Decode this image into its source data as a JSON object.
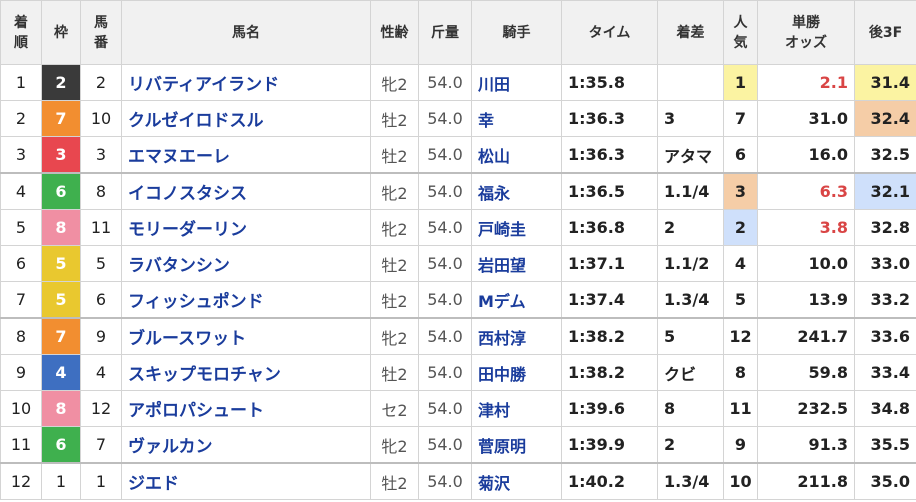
{
  "headers": {
    "rank": "着\n順",
    "frame": "枠",
    "number": "馬\n番",
    "horse": "馬名",
    "sexage": "性齢",
    "weight": "斤量",
    "jockey": "騎手",
    "time": "タイム",
    "margin": "着差",
    "popularity": "人\n気",
    "odds": "単勝\nオッズ",
    "last3f": "後3F"
  },
  "frame_colors": {
    "1": {
      "bg": "#ffffff",
      "fg": "#222222"
    },
    "2": {
      "bg": "#3a3a3a",
      "fg": "#ffffff"
    },
    "3": {
      "bg": "#e8474f",
      "fg": "#ffffff"
    },
    "4": {
      "bg": "#3e6fc1",
      "fg": "#ffffff"
    },
    "5": {
      "bg": "#e9c82f",
      "fg": "#ffffff"
    },
    "6": {
      "bg": "#3fb04e",
      "fg": "#ffffff"
    },
    "7": {
      "bg": "#f28e30",
      "fg": "#ffffff"
    },
    "8": {
      "bg": "#f08fa3",
      "fg": "#ffffff"
    }
  },
  "rows": [
    {
      "rank": "1",
      "frame": "2",
      "number": "2",
      "horse": "リバティアイランド",
      "sexage": "牝2",
      "weight": "54.0",
      "jockey": "川田",
      "time": "1:35.8",
      "margin": "",
      "popularity": "1",
      "odds": "2.1",
      "last3f": "31.4",
      "odds_hot": true,
      "l3f_rank": 1
    },
    {
      "rank": "2",
      "frame": "7",
      "number": "10",
      "horse": "クルゼイロドスル",
      "sexage": "牡2",
      "weight": "54.0",
      "jockey": "幸",
      "time": "1:36.3",
      "margin": "3",
      "popularity": "7",
      "odds": "31.0",
      "last3f": "32.4",
      "odds_hot": false,
      "l3f_rank": 3
    },
    {
      "rank": "3",
      "frame": "3",
      "number": "3",
      "horse": "エマヌエーレ",
      "sexage": "牡2",
      "weight": "54.0",
      "jockey": "松山",
      "time": "1:36.3",
      "margin": "アタマ",
      "popularity": "6",
      "odds": "16.0",
      "last3f": "32.5",
      "odds_hot": false,
      "l3f_rank": 0
    },
    {
      "rank": "4",
      "frame": "6",
      "number": "8",
      "horse": "イコノスタシス",
      "sexage": "牝2",
      "weight": "54.0",
      "jockey": "福永",
      "time": "1:36.5",
      "margin": "1.1/4",
      "popularity": "3",
      "odds": "6.3",
      "last3f": "32.1",
      "odds_hot": true,
      "l3f_rank": 2
    },
    {
      "rank": "5",
      "frame": "8",
      "number": "11",
      "horse": "モリーダーリン",
      "sexage": "牝2",
      "weight": "54.0",
      "jockey": "戸崎圭",
      "time": "1:36.8",
      "margin": "2",
      "popularity": "2",
      "odds": "3.8",
      "last3f": "32.8",
      "odds_hot": true,
      "l3f_rank": 0
    },
    {
      "rank": "6",
      "frame": "5",
      "number": "5",
      "horse": "ラバタンシン",
      "sexage": "牡2",
      "weight": "54.0",
      "jockey": "岩田望",
      "time": "1:37.1",
      "margin": "1.1/2",
      "popularity": "4",
      "odds": "10.0",
      "last3f": "33.0",
      "odds_hot": false,
      "l3f_rank": 0
    },
    {
      "rank": "7",
      "frame": "5",
      "number": "6",
      "horse": "フィッシュポンド",
      "sexage": "牡2",
      "weight": "54.0",
      "jockey": "Mデム",
      "time": "1:37.4",
      "margin": "1.3/4",
      "popularity": "5",
      "odds": "13.9",
      "last3f": "33.2",
      "odds_hot": false,
      "l3f_rank": 0
    },
    {
      "rank": "8",
      "frame": "7",
      "number": "9",
      "horse": "ブルースワット",
      "sexage": "牝2",
      "weight": "54.0",
      "jockey": "西村淳",
      "time": "1:38.2",
      "margin": "5",
      "popularity": "12",
      "odds": "241.7",
      "last3f": "33.6",
      "odds_hot": false,
      "l3f_rank": 0
    },
    {
      "rank": "9",
      "frame": "4",
      "number": "4",
      "horse": "スキップモロチャン",
      "sexage": "牡2",
      "weight": "54.0",
      "jockey": "田中勝",
      "time": "1:38.2",
      "margin": "クビ",
      "popularity": "8",
      "odds": "59.8",
      "last3f": "33.4",
      "odds_hot": false,
      "l3f_rank": 0
    },
    {
      "rank": "10",
      "frame": "8",
      "number": "12",
      "horse": "アポロパシュート",
      "sexage": "セ2",
      "weight": "54.0",
      "jockey": "津村",
      "time": "1:39.6",
      "margin": "8",
      "popularity": "11",
      "odds": "232.5",
      "last3f": "34.8",
      "odds_hot": false,
      "l3f_rank": 0
    },
    {
      "rank": "11",
      "frame": "6",
      "number": "7",
      "horse": "ヴァルカン",
      "sexage": "牝2",
      "weight": "54.0",
      "jockey": "菅原明",
      "time": "1:39.9",
      "margin": "2",
      "popularity": "9",
      "odds": "91.3",
      "last3f": "35.5",
      "odds_hot": false,
      "l3f_rank": 0
    },
    {
      "rank": "12",
      "frame": "1",
      "number": "1",
      "horse": "ジエド",
      "sexage": "牡2",
      "weight": "54.0",
      "jockey": "菊沢",
      "time": "1:40.2",
      "margin": "1.3/4",
      "popularity": "10",
      "odds": "211.8",
      "last3f": "35.0",
      "odds_hot": false,
      "l3f_rank": 0
    }
  ]
}
